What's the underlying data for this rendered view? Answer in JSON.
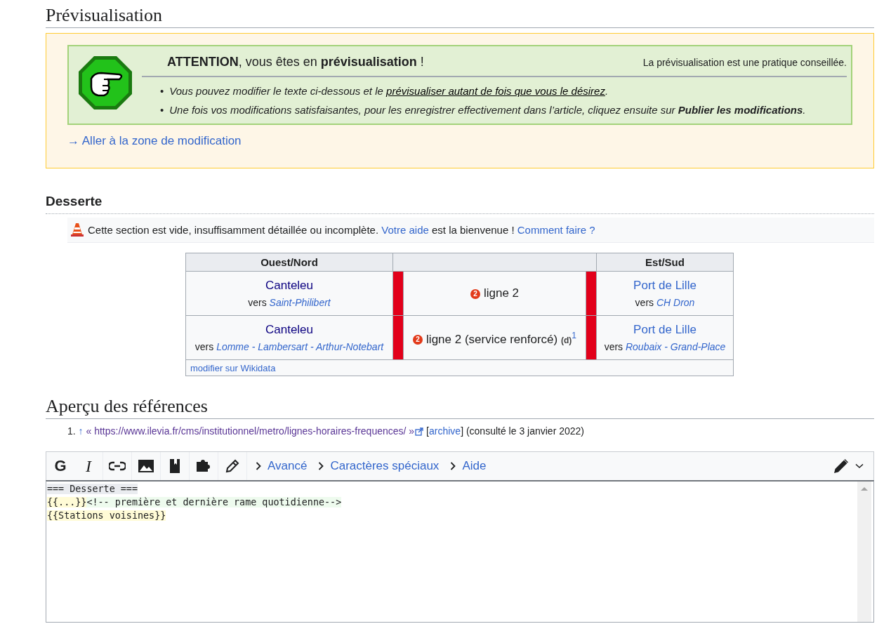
{
  "preview_heading": "Prévisualisation",
  "notice": {
    "title": "**ATTENTION**, vous êtes en **prévisualisation** !",
    "tip": "La prévisualisation est une pratique conseillée.",
    "bullets": [
      {
        "marker": "•",
        "before": "Vous pouvez modifier le texte ci-dessous et le ",
        "link": "prévisualiser autant de fois que vous le désirez",
        "after": "."
      },
      {
        "marker": "•",
        "before": "Une fois vos modifications satisfaisantes, pour les enregistrer effectivement dans l’article, cliquez ensuite sur **Publier les modifications**."
      }
    ],
    "jump_link": "→ Aller à la zone de modification"
  },
  "section": {
    "heading": "Desserte",
    "stub": {
      "text": "Cette section est vide, insuffisamment détaillée ou incomplète.",
      "help_link": "Votre aide",
      "middle": "est la bienvenue !",
      "how_link": "Comment faire ?"
    },
    "table": {
      "columns": [
        "Ouest/Nord",
        "Est/Sud"
      ],
      "rows": [
        {
          "west": "Canteleu",
          "west_via_prefix": "vers",
          "west_via": "Saint-Philibert",
          "badge": "2",
          "line": "ligne 2",
          "east": "Port de Lille",
          "east_via_prefix": "vers",
          "east_via": "CH Dron"
        },
        {
          "west": "Canteleu",
          "west_via_prefix": "vers",
          "west_via": "Lomme - Lambersart - Arthur-Notebart",
          "badge": "2",
          "line": "ligne 2 (service renforcé)",
          "line_note": "(d)",
          "footnote": "1",
          "east": "Port de Lille",
          "east_via_prefix": "vers",
          "east_via": "Roubaix - Grand-Place"
        }
      ],
      "footer_link": "modifier sur Wikidata"
    }
  },
  "references": {
    "heading": "Aperçu des références",
    "items": [
      {
        "number": "1.",
        "back": "↑",
        "url": "« https://www.ilevia.fr/cms/institutionnel/metro/lignes-horaires-frequences/ »",
        "archive_open": "[",
        "archive": "archive",
        "archive_close": "]",
        "accessed": "(consulté le 3 janvier 2022)"
      }
    ]
  },
  "editor": {
    "format_buttons": [
      {
        "kind": "bold",
        "label": "G"
      },
      {
        "kind": "italic",
        "label": "I"
      }
    ],
    "menus": [
      {
        "label": "Avancé",
        "expanded": false
      },
      {
        "label": "Caractères spéciaux",
        "expanded": false
      },
      {
        "label": "Aide",
        "expanded": false
      }
    ],
    "lines": [
      [
        {
          "kind": "heading",
          "text": "=== Desserte ==="
        }
      ],
      [
        {
          "kind": "template",
          "text": "{{...}}"
        },
        {
          "kind": "comment",
          "text": "<!-- première et dernière rame quotidienne-->"
        }
      ],
      [
        {
          "kind": "template",
          "text": "{{Stations voisines}}"
        }
      ]
    ]
  }
}
